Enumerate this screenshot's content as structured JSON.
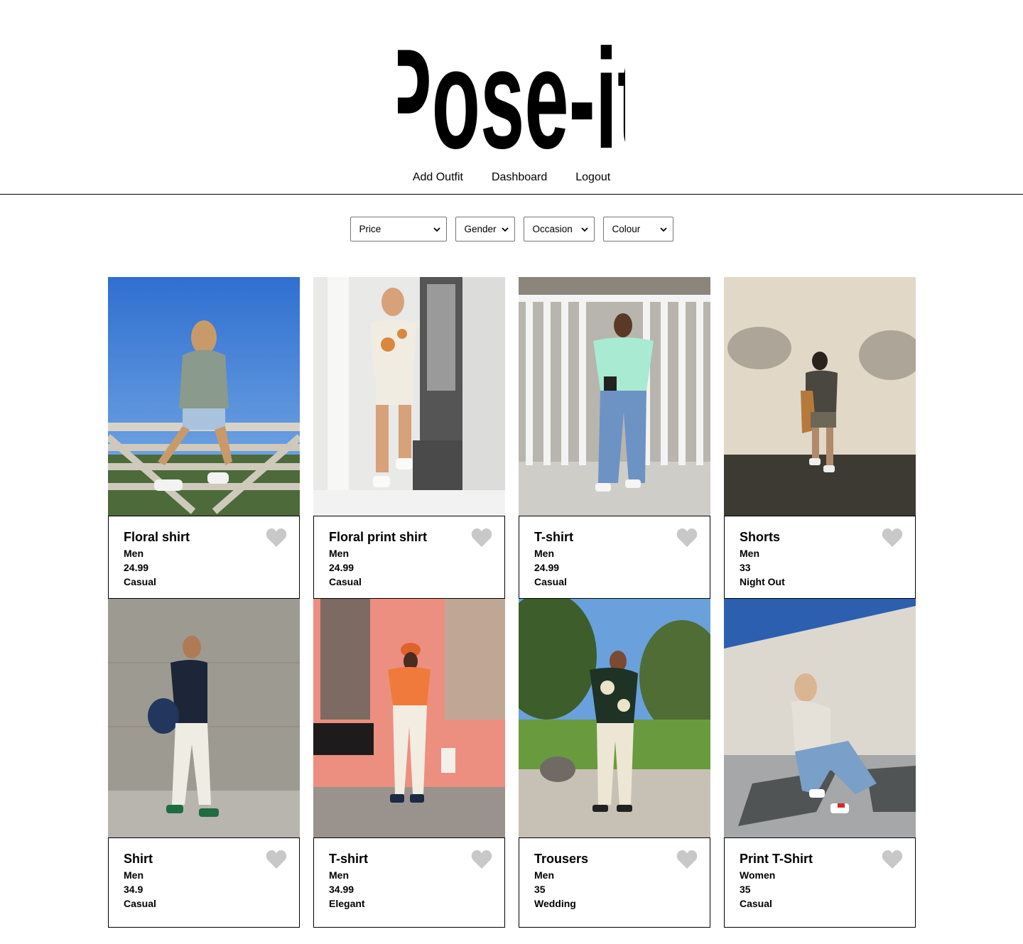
{
  "brand": {
    "logo_text": "Pose-it"
  },
  "nav": {
    "items": [
      {
        "label": "Add Outfit"
      },
      {
        "label": "Dashboard"
      },
      {
        "label": "Logout"
      }
    ]
  },
  "filters": {
    "price": "Price",
    "gender": "Gender",
    "occasion": "Occasion",
    "colour": "Colour"
  },
  "colors": {
    "heart": "#c8c8c8",
    "border": "#000000"
  },
  "outfits": [
    {
      "name": "Floral shirt",
      "gender": "Men",
      "price": "24.99",
      "occasion": "Casual",
      "photo": "man-floral-shirt-on-fence-photo"
    },
    {
      "name": "Floral print shirt",
      "gender": "Men",
      "price": "24.99",
      "occasion": "Casual",
      "photo": "man-mirror-selfie-photo"
    },
    {
      "name": "T-shirt",
      "gender": "Men",
      "price": "24.99",
      "occasion": "Casual",
      "photo": "man-mint-tshirt-gate-photo"
    },
    {
      "name": "Shorts",
      "gender": "Men",
      "price": "33",
      "occasion": "Night Out",
      "photo": "man-shorts-wall-shadow-photo"
    },
    {
      "name": "Shirt",
      "gender": "Men",
      "price": "34.9",
      "occasion": "Casual",
      "photo": "man-navy-shirt-concrete-photo"
    },
    {
      "name": "T-shirt",
      "gender": "Men",
      "price": "34.99",
      "occasion": "Elegant",
      "photo": "man-orange-hat-pink-wall-photo"
    },
    {
      "name": "Trousers",
      "gender": "Men",
      "price": "35",
      "occasion": "Wedding",
      "photo": "man-trousers-park-photo"
    },
    {
      "name": "Print T-Shirt",
      "gender": "Women",
      "price": "35",
      "occasion": "Casual",
      "photo": "woman-crouching-jeans-photo"
    }
  ]
}
